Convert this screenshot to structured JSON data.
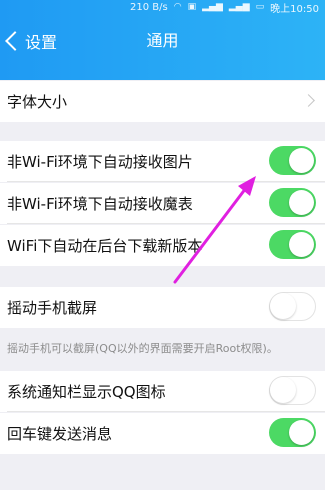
{
  "status_bar": {
    "speed": "210 B/s",
    "time": "晚上10:50",
    "icons": [
      "wifi-icon",
      "hd-icon",
      "signal-icon",
      "signal-icon",
      "battery-icon"
    ]
  },
  "nav": {
    "back_label": "设置",
    "title": "通用"
  },
  "settings": {
    "font_size": "字体大小",
    "auto_receive_images": {
      "label": "非Wi-Fi环境下自动接收图片",
      "enabled": true
    },
    "auto_receive_emoticons": {
      "label": "非Wi-Fi环境下自动接收魔表",
      "enabled": true
    },
    "auto_download_update": {
      "label": "WiFi下自动在后台下载新版本",
      "enabled": true
    },
    "shake_screenshot": {
      "label": "摇动手机截屏",
      "enabled": false
    },
    "shake_screenshot_note": "摇动手机可以截屏(QQ以外的界面需要开启Root权限)。",
    "notification_bar_icon": {
      "label": "系统通知栏显示QQ图标",
      "enabled": false
    },
    "enter_to_send": {
      "label": "回车键发送消息",
      "enabled": true
    }
  },
  "colors": {
    "header_start": "#1f9af3",
    "header_end": "#2db3f6",
    "toggle_on": "#4cd964",
    "annotation_arrow": "#e020e0"
  }
}
